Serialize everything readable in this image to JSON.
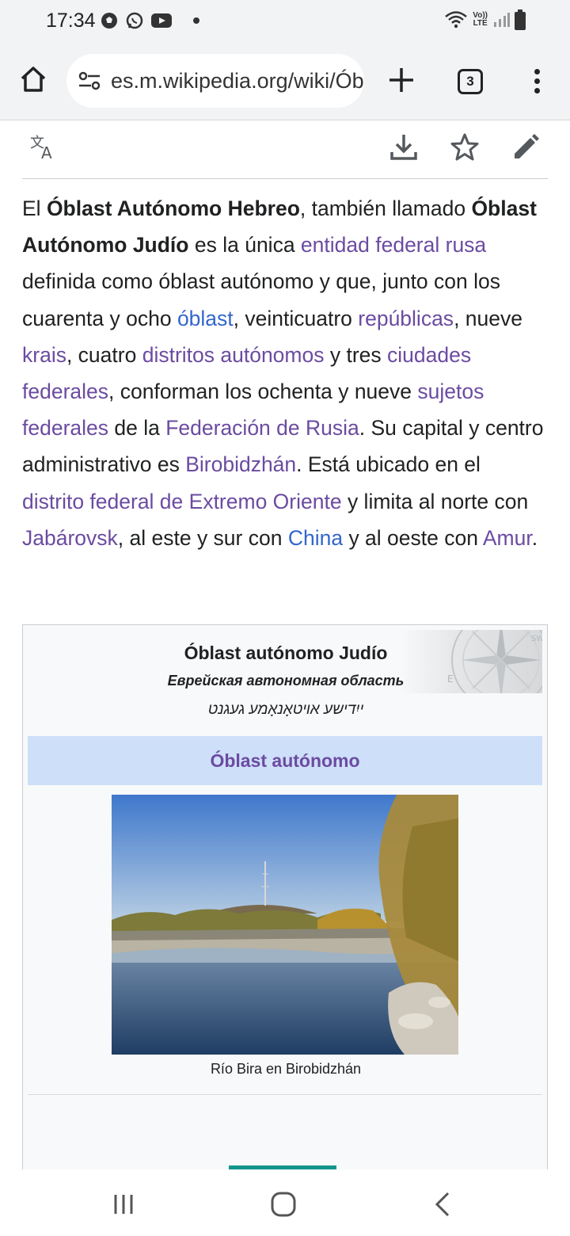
{
  "status_bar": {
    "time": "17:34",
    "left_icons": [
      "soccer-ball-icon",
      "whatsapp-icon",
      "youtube-icon"
    ],
    "network_top": "Vo))",
    "network_bottom": "LTE"
  },
  "browser": {
    "url": "es.m.wikipedia.org/wiki/Óbl",
    "tab_count": "3"
  },
  "page_actions": [
    "translate-icon",
    "download-icon",
    "star-icon",
    "edit-icon"
  ],
  "article": {
    "segments": [
      {
        "text": "El ",
        "type": "text"
      },
      {
        "text": "Óblast Autónomo Hebreo",
        "type": "bold"
      },
      {
        "text": ", también llamado ",
        "type": "text"
      },
      {
        "text": "Óblast Autónomo Judío",
        "type": "bold"
      },
      {
        "text": " es la única ",
        "type": "text"
      },
      {
        "text": "entidad federal rusa",
        "type": "link"
      },
      {
        "text": " definida como óblast autónomo y que, junto con los cuarenta y ocho ",
        "type": "text"
      },
      {
        "text": "óblast",
        "type": "link-blue"
      },
      {
        "text": ", veinticuatro ",
        "type": "text"
      },
      {
        "text": "repúblicas",
        "type": "link"
      },
      {
        "text": ", nueve ",
        "type": "text"
      },
      {
        "text": "krais",
        "type": "link"
      },
      {
        "text": ", cuatro ",
        "type": "text"
      },
      {
        "text": "distritos autónomos",
        "type": "link"
      },
      {
        "text": " y tres ",
        "type": "text"
      },
      {
        "text": "ciudades federales",
        "type": "link"
      },
      {
        "text": ", conforman los ochenta y nueve ",
        "type": "text"
      },
      {
        "text": "sujetos federales",
        "type": "link"
      },
      {
        "text": " de la ",
        "type": "text"
      },
      {
        "text": "Federación de Rusia",
        "type": "link"
      },
      {
        "text": ". Su capital y centro administrativo es ",
        "type": "text"
      },
      {
        "text": "Birobidzhán",
        "type": "link"
      },
      {
        "text": ". Está ubicado en el ",
        "type": "text"
      },
      {
        "text": "distrito federal de Extremo Oriente",
        "type": "link"
      },
      {
        "text": " y limita al norte con ",
        "type": "text"
      },
      {
        "text": "Jabárovsk",
        "type": "link"
      },
      {
        "text": ", al este y sur con ",
        "type": "text"
      },
      {
        "text": "China",
        "type": "link-blue"
      },
      {
        "text": " y al oeste con ",
        "type": "text"
      },
      {
        "text": "Amur",
        "type": "link"
      },
      {
        "text": ".",
        "type": "text"
      }
    ]
  },
  "infobox": {
    "title": "Óblast autónomo Judío",
    "subtitle": "Еврейская автономная область",
    "yiddish": "ייִדישע אױטאָנאָמע געגנט",
    "type_label": "Óblast autónomo",
    "photo_caption": "Río Bira en Birobidzhán"
  },
  "colors": {
    "link": "#6b4ba1",
    "link_blue": "#3366cc",
    "band": "#cedff9",
    "progress": "#14958c"
  },
  "nav_bar": [
    "recents-icon",
    "home-icon",
    "back-icon"
  ]
}
